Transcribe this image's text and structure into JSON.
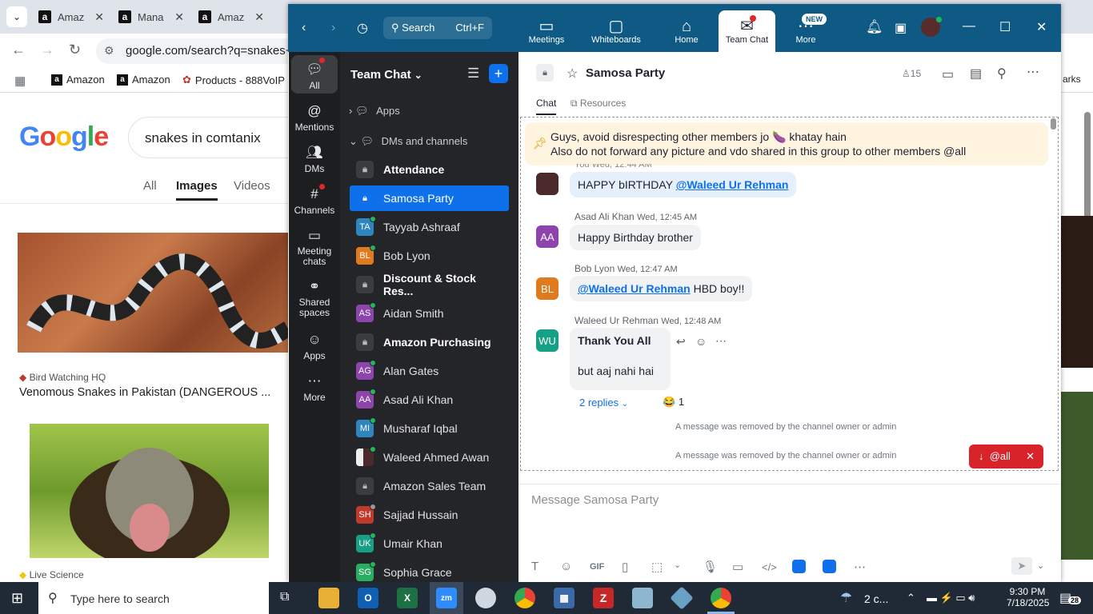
{
  "browser": {
    "tabs": [
      "Amaz",
      "Mana",
      "Amaz"
    ],
    "url": "google.com/search?q=snakes+in",
    "bookmarks": [
      "Amazon",
      "Amazon",
      "Products - 888VoIP"
    ],
    "bookmarks_overflow": "arks",
    "search_query": "snakes in comtanix",
    "google_logo": "Google",
    "search_tabs": [
      "All",
      "Images",
      "Videos"
    ],
    "results": [
      {
        "source": "Bird Watching HQ",
        "title": "Venomous Snakes in Pakistan (DANGEROUS ..."
      },
      {
        "source": "Live Science"
      }
    ]
  },
  "zoom": {
    "search": {
      "label": "Search",
      "shortcut": "Ctrl+F"
    },
    "top_nav": [
      {
        "label": "Meetings",
        "icon": "camera-icon"
      },
      {
        "label": "Whiteboards",
        "icon": "whiteboard-icon"
      },
      {
        "label": "Home",
        "icon": "home-icon"
      },
      {
        "label": "Team Chat",
        "icon": "chat-icon"
      },
      {
        "label": "More",
        "icon": "more-icon",
        "badge": "NEW"
      }
    ],
    "rail": [
      "All",
      "Mentions",
      "DMs",
      "Channels",
      "Meeting chats",
      "Shared spaces",
      "Apps",
      "More"
    ],
    "sidebar": {
      "title": "Team Chat",
      "sections": [
        "Apps",
        "DMs and channels"
      ],
      "items": [
        {
          "label": "Attendance",
          "type": "channel",
          "bold": true
        },
        {
          "label": "Samosa Party",
          "type": "channel",
          "selected": true
        },
        {
          "label": "Tayyab Ashraaf",
          "initials": "TA",
          "color": "#2e86c1"
        },
        {
          "label": "Bob Lyon",
          "initials": "BL",
          "color": "#e07a1f"
        },
        {
          "label": "Discount & Stock Res...",
          "type": "channel",
          "bold": true
        },
        {
          "label": "Aidan Smith",
          "initials": "AS",
          "color": "#8e44ad"
        },
        {
          "label": "Amazon Purchasing",
          "type": "channel",
          "bold": true
        },
        {
          "label": "Alan Gates",
          "initials": "AG",
          "color": "#8e44ad"
        },
        {
          "label": "Asad Ali Khan",
          "initials": "AA",
          "color": "#8e44ad"
        },
        {
          "label": "Musharaf Iqbal",
          "initials": "MI",
          "color": "#2e86c1"
        },
        {
          "label": "Waleed Ahmed Awan",
          "initials": "",
          "color": "#555"
        },
        {
          "label": "Amazon Sales Team",
          "type": "channel"
        },
        {
          "label": "Sajjad Hussain",
          "initials": "SH",
          "color": "#c0392b"
        },
        {
          "label": "Umair Khan",
          "initials": "UK",
          "color": "#16a085"
        },
        {
          "label": "Sophia Grace",
          "initials": "SG",
          "color": "#27ae60"
        }
      ]
    },
    "chat": {
      "channel_name": "Samosa Party",
      "member_count": "15",
      "tabs": [
        "Chat",
        "Resources"
      ],
      "pinned": [
        "Guys, avoid disrespecting other members jo 🍆 khatay hain",
        "Also do not forward any picture and vdo shared in this group to other members @all"
      ],
      "partial_header": "You Wed, 12:44 AM",
      "messages": [
        {
          "sender": "",
          "text": "HAPPY bIRTHDAY ",
          "mention": "@Waleed Ur Rehman"
        },
        {
          "sender": "Asad Ali Khan",
          "time": "Wed, 12:45 AM",
          "initials": "AA",
          "text": "Happy Birthday brother"
        },
        {
          "sender": "Bob Lyon",
          "time": "Wed, 12:47 AM",
          "initials": "BL",
          "mention": "@Waleed Ur Rehman",
          "text": " HBD boy!!"
        },
        {
          "sender": "Waleed Ur Rehman",
          "time": "Wed, 12:48 AM",
          "initials": "WU",
          "text": "Thank You All",
          "text2": "but aaj nahi hai"
        }
      ],
      "replies": "2 replies",
      "reaction_count": "1",
      "removed": "A message was removed by the channel owner or admin",
      "jump_label": "@all",
      "composer_placeholder": "Message Samosa Party",
      "gif_label": "GIF"
    }
  },
  "taskbar": {
    "search_placeholder": "Type here to search",
    "weather": "2 c...",
    "time": "9:30 PM",
    "date": "7/18/2025",
    "notifications": "28"
  }
}
